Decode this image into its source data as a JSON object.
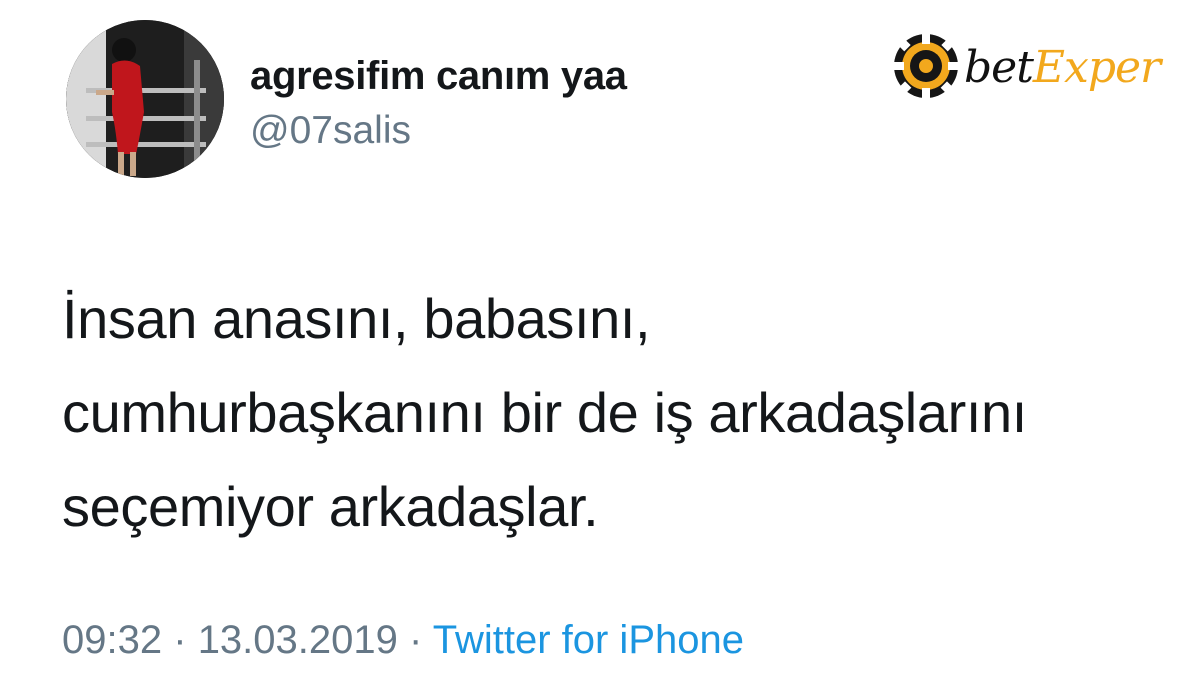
{
  "author": {
    "display_name": "agresifim canım yaa",
    "handle": "@07salis"
  },
  "watermark": {
    "brand_part1": "bet",
    "brand_part2": "Exper",
    "accent_color": "#f2a81d",
    "icon": "poker-chip-icon"
  },
  "tweet": {
    "lines": [
      "İnsan anasını, babasını,",
      "cumhurbaşkanını bir de iş arkadaşlarını",
      "seçemiyor arkadaşlar."
    ]
  },
  "meta": {
    "time": "09:32",
    "separator": "·",
    "date": "13.03.2019",
    "source": "Twitter for iPhone",
    "link_color": "#1b95e0"
  }
}
